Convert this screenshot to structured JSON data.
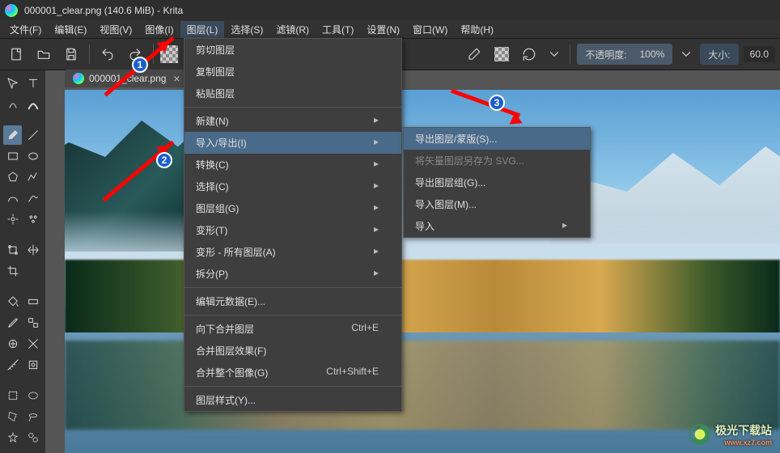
{
  "title": "000001_clear.png (140.6 MiB)  - Krita",
  "menubar": [
    "文件(F)",
    "编辑(E)",
    "视图(V)",
    "图像(I)",
    "图层(L)",
    "选择(S)",
    "滤镜(R)",
    "工具(T)",
    "设置(N)",
    "窗口(W)",
    "帮助(H)"
  ],
  "active_menu_index": 4,
  "toolbar": {
    "opacity_label": "不透明度:",
    "opacity_value": "100%",
    "size_label": "大小:",
    "size_value": "60.0"
  },
  "tab": {
    "filename": "000001_clear.png",
    "close": "×"
  },
  "layer_menu": [
    {
      "label": "剪切图层",
      "type": "item"
    },
    {
      "label": "复制图层",
      "type": "item"
    },
    {
      "label": "粘贴图层",
      "type": "item"
    },
    {
      "type": "sep"
    },
    {
      "label": "新建(N)",
      "type": "sub"
    },
    {
      "label": "导入/导出(I)",
      "type": "sub",
      "highlight": true
    },
    {
      "label": "转换(C)",
      "type": "sub"
    },
    {
      "label": "选择(C)",
      "type": "sub"
    },
    {
      "label": "图层组(G)",
      "type": "sub"
    },
    {
      "label": "变形(T)",
      "type": "sub"
    },
    {
      "label": "变形 - 所有图层(A)",
      "type": "sub"
    },
    {
      "label": "拆分(P)",
      "type": "sub"
    },
    {
      "type": "sep"
    },
    {
      "label": "编辑元数据(E)...",
      "type": "item"
    },
    {
      "type": "sep"
    },
    {
      "label": "向下合并图层",
      "shortcut": "Ctrl+E",
      "type": "item"
    },
    {
      "label": "合并图层效果(F)",
      "type": "item"
    },
    {
      "label": "合并整个图像(G)",
      "shortcut": "Ctrl+Shift+E",
      "type": "item"
    },
    {
      "type": "sep"
    },
    {
      "label": "图层样式(Y)...",
      "type": "item"
    }
  ],
  "submenu": [
    {
      "label": "导出图层/蒙版(S)...",
      "highlight": true
    },
    {
      "label": "将矢量图层另存为 SVG...",
      "disabled": true
    },
    {
      "label": "导出图层组(G)...",
      "type": "item"
    },
    {
      "label": "导入图层(M)...",
      "type": "item"
    },
    {
      "label": "导入",
      "type": "sub"
    }
  ],
  "annotations": {
    "n1": "1",
    "n2": "2",
    "n3": "3"
  },
  "watermark": {
    "text": "极光下载站",
    "url": "www.xz7.com"
  }
}
